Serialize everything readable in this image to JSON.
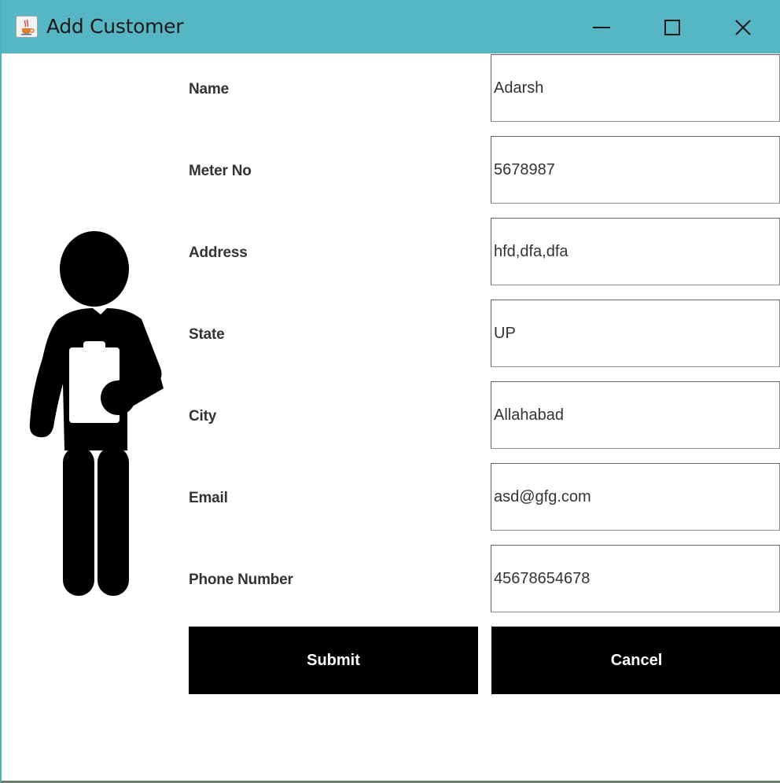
{
  "window": {
    "title": "Add Customer",
    "app_icon": "java-cup-icon",
    "controls": {
      "minimize": "minimize-icon",
      "maximize": "maximize-icon",
      "close": "close-icon"
    },
    "titlebar_color": "#56b6c4"
  },
  "illustration": "person-with-clipboard-icon",
  "form": {
    "fields": [
      {
        "label": "Name",
        "value": "Adarsh"
      },
      {
        "label": "Meter No",
        "value": "5678987"
      },
      {
        "label": "Address",
        "value": "hfd,dfa,dfa"
      },
      {
        "label": "State",
        "value": "UP"
      },
      {
        "label": "City",
        "value": "Allahabad"
      },
      {
        "label": "Email",
        "value": "asd@gfg.com"
      },
      {
        "label": "Phone Number",
        "value": "45678654678"
      }
    ],
    "submit_label": "Submit",
    "cancel_label": "Cancel",
    "button_color": "#000000"
  }
}
